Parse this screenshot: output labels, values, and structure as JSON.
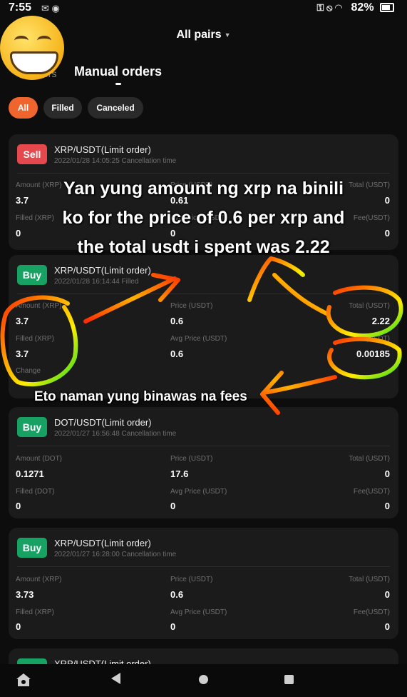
{
  "status": {
    "time": "7:55",
    "battery": "82%"
  },
  "header": {
    "pairs_label": "All pairs"
  },
  "tabs": {
    "other_fragment": "ers",
    "active": "Manual orders"
  },
  "filters": [
    "All",
    "Filled",
    "Canceled"
  ],
  "orders": [
    {
      "side": "Sell",
      "title": "XRP/USDT(Limit order)",
      "subtitle": "2022/01/28 14:05:25 Cancellation time",
      "amount_label": "Amount (XRP)",
      "amount": "3.7",
      "price_label": "Price (USDT)",
      "price": "0.61",
      "total_label": "Total (USDT)",
      "total": "0",
      "filled_label": "Filled (XRP)",
      "filled": "0",
      "avg_label": "Avg Price (USDT)",
      "avg": "0",
      "fee_label": "Fee(USDT)",
      "fee": "0"
    },
    {
      "side": "Buy",
      "title": "XRP/USDT(Limit order)",
      "subtitle": "2022/01/28 16:14:44 Filled",
      "amount_label": "Amount (XRP)",
      "amount": "3.7",
      "price_label": "Price (USDT)",
      "price": "0.6",
      "total_label": "Total (USDT)",
      "total": "2.22",
      "filled_label": "Filled (XRP)",
      "filled": "3.7",
      "avg_label": "Avg Price (USDT)",
      "avg": "0.6",
      "fee_label": "Fee(USDT)",
      "fee": "0.00185",
      "change_label": "Change"
    },
    {
      "side": "Buy",
      "title": "DOT/USDT(Limit order)",
      "subtitle": "2022/01/27 16:56:48 Cancellation time",
      "amount_label": "Amount (DOT)",
      "amount": "0.1271",
      "price_label": "Price (USDT)",
      "price": "17.6",
      "total_label": "Total (USDT)",
      "total": "0",
      "filled_label": "Filled (DOT)",
      "filled": "0",
      "avg_label": "Avg Price (USDT)",
      "avg": "0",
      "fee_label": "Fee(USDT)",
      "fee": "0"
    },
    {
      "side": "Buy",
      "title": "XRP/USDT(Limit order)",
      "subtitle": "2022/01/27 16:28:00 Cancellation time",
      "amount_label": "Amount (XRP)",
      "amount": "3.73",
      "price_label": "Price (USDT)",
      "price": "0.6",
      "total_label": "Total (USDT)",
      "total": "0",
      "filled_label": "Filled (XRP)",
      "filled": "0",
      "avg_label": "Avg Price (USDT)",
      "avg": "0",
      "fee_label": "Fee(USDT)",
      "fee": "0"
    },
    {
      "side": "Buy",
      "title": "XRP/USDT(Limit order)"
    }
  ],
  "annotations": {
    "main_caption_lines": [
      "Yan yung amount ng xrp na binili",
      "ko for the price of 0.6 per xrp and",
      "the total usdt i spent was 2.22"
    ],
    "fee_caption": "Eto naman yung binawas na fees"
  },
  "colors": {
    "accent": "#f0642e",
    "sell": "#e5484d",
    "buy": "#17a264",
    "card": "#1b1b1b"
  },
  "icons": {
    "emoji": "grinning-face-emoji",
    "nav": [
      "app-icon",
      "back-icon",
      "home-icon",
      "recents-icon"
    ]
  }
}
